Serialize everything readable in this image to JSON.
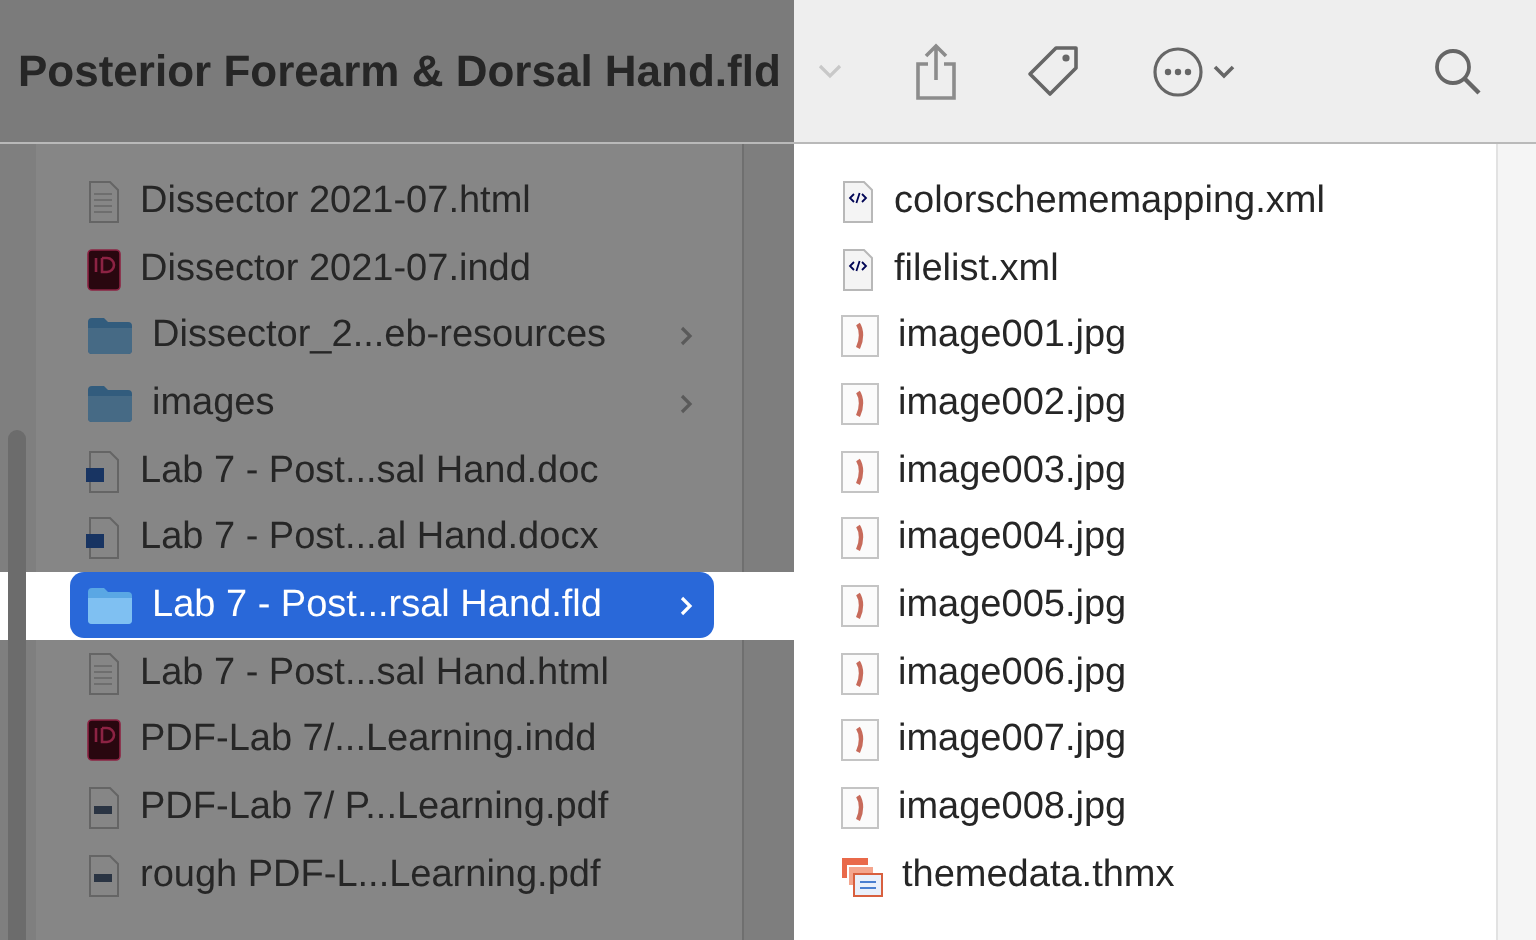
{
  "toolbar": {
    "title": "Posterior Forearm & Dorsal Hand.fld"
  },
  "left_column": {
    "items": [
      {
        "name": "Dissector 2021-07.html",
        "kind": "html",
        "selected": false
      },
      {
        "name": "Dissector 2021-07.indd",
        "kind": "indd",
        "selected": false
      },
      {
        "name": "Dissector_2...eb-resources",
        "kind": "folder",
        "selected": false
      },
      {
        "name": "images",
        "kind": "folder",
        "selected": false
      },
      {
        "name": "Lab 7 - Post...sal Hand.doc",
        "kind": "doc",
        "selected": false
      },
      {
        "name": "Lab 7 - Post...al Hand.docx",
        "kind": "doc",
        "selected": false
      },
      {
        "name": "Lab 7 - Post...rsal Hand.fld",
        "kind": "folder",
        "selected": true
      },
      {
        "name": "Lab 7 - Post...sal Hand.html",
        "kind": "html",
        "selected": false
      },
      {
        "name": "PDF-Lab 7/...Learning.indd",
        "kind": "indd",
        "selected": false
      },
      {
        "name": "PDF-Lab 7/ P...Learning.pdf",
        "kind": "pdf",
        "selected": false
      },
      {
        "name": "rough PDF-L...Learning.pdf",
        "kind": "pdf",
        "selected": false
      }
    ]
  },
  "right_column": {
    "items": [
      {
        "name": "colorschememapping.xml",
        "kind": "xml"
      },
      {
        "name": "filelist.xml",
        "kind": "xml"
      },
      {
        "name": "image001.jpg",
        "kind": "jpg"
      },
      {
        "name": "image002.jpg",
        "kind": "jpg"
      },
      {
        "name": "image003.jpg",
        "kind": "jpg"
      },
      {
        "name": "image004.jpg",
        "kind": "jpg"
      },
      {
        "name": "image005.jpg",
        "kind": "jpg"
      },
      {
        "name": "image006.jpg",
        "kind": "jpg"
      },
      {
        "name": "image007.jpg",
        "kind": "jpg"
      },
      {
        "name": "image008.jpg",
        "kind": "jpg"
      },
      {
        "name": "themedata.thmx",
        "kind": "thmx"
      }
    ]
  }
}
